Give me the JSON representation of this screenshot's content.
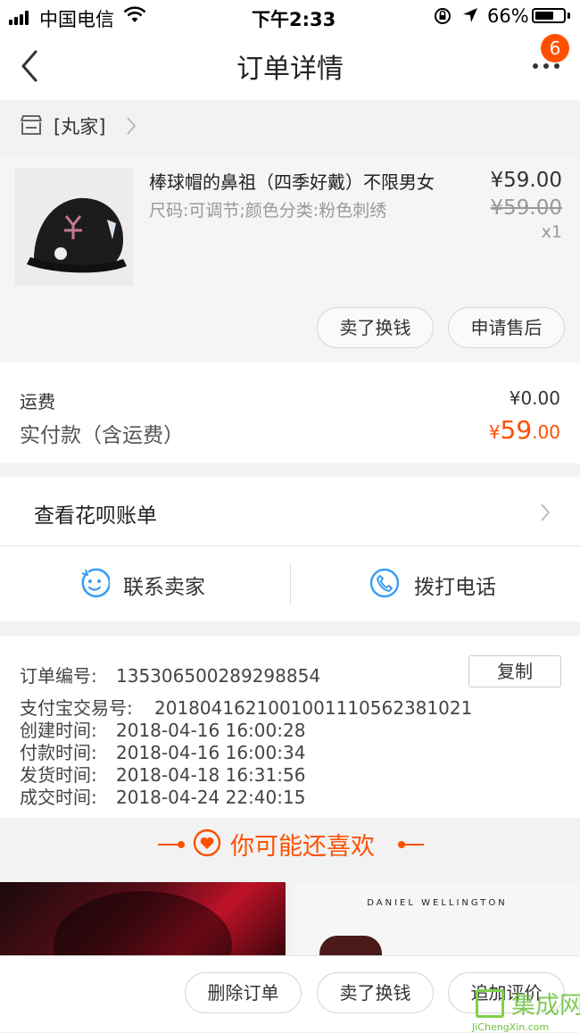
{
  "status_bar": {
    "carrier": "中国电信",
    "time": "下午2:33",
    "battery": "66%",
    "battery_level": 0.66
  },
  "nav": {
    "title": "订单详情",
    "more_badge": "6"
  },
  "shop": {
    "name": "[丸家]"
  },
  "product": {
    "title": "棒球帽的鼻祖（四季好戴）不限男女",
    "sku": "尺码:可调节;颜色分类:粉色刺绣",
    "price": "¥59.00",
    "original_price": "¥59.00",
    "quantity": "x1",
    "btn_exchange": "卖了换钱",
    "btn_aftersale": "申请售后"
  },
  "fees": {
    "shipping_label": "运费",
    "shipping_value": "¥0.00",
    "paid_label": "实付款（含运费）",
    "paid_currency": "¥",
    "paid_int": "59",
    "paid_dec": ".00"
  },
  "huabei": {
    "label": "查看花呗账单"
  },
  "contact": {
    "seller": "联系卖家",
    "phone": "拨打电话"
  },
  "order": {
    "number_label": "订单编号:",
    "number": "135306500289298854",
    "copy": "复制",
    "alipay_label": "支付宝交易号:",
    "alipay": "2018041621001001110562381021",
    "created_label": "创建时间:",
    "created": "2018-04-16 16:00:28",
    "paid_label": "付款时间:",
    "paid": "2018-04-16 16:00:34",
    "shipped_label": "发货时间:",
    "shipped": "2018-04-18 16:31:56",
    "closed_label": "成交时间:",
    "closed": "2018-04-24 22:40:15"
  },
  "recommend": {
    "title": "你可能还喜欢",
    "brand_text": "DANIEL WELLINGTON"
  },
  "bottom": {
    "delete": "删除订单",
    "exchange": "卖了换钱",
    "review": "追加评价"
  },
  "watermark": {
    "text": "集成网",
    "sub": "JiChengXin.com"
  },
  "colors": {
    "accent": "#ff5000",
    "icon_blue": "#3b9cf2"
  }
}
